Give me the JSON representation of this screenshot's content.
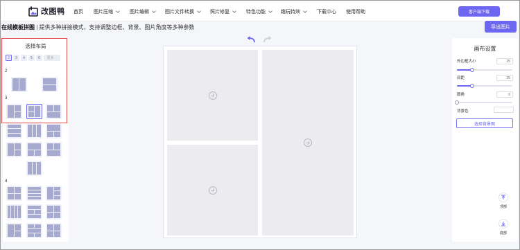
{
  "brand": {
    "name": "改图鸭"
  },
  "nav": {
    "items": [
      "首页",
      "图片压缩",
      "图片编辑",
      "图片文件转换",
      "照片修复",
      "特色功能",
      "趣玩特效",
      "下载中心",
      "使用帮助"
    ],
    "client_download": "客户端下载"
  },
  "subheader": {
    "title": "在线模板拼图",
    "separator": " | ",
    "description": "提供多种拼接模式，支持调整边框、背景、图片角度等多种参数",
    "export_button": "导出图片"
  },
  "layout_panel": {
    "title": "选择布局",
    "count_tabs": [
      "2",
      "3",
      "4",
      "5",
      "6",
      "更多 ··"
    ],
    "active_tab": "2",
    "sections": [
      "2",
      "3",
      "4"
    ]
  },
  "canvas_panel": {
    "title": "画布设置",
    "outer_border_label": "外边框大小",
    "outer_border_value": "25",
    "outer_border_fraction": 0.28,
    "spacing_label": "间距",
    "spacing_value": "25",
    "spacing_fraction": 0.28,
    "corner_label": "圆角",
    "corner_value": "0",
    "corner_fraction": 0,
    "bg_color_label": "背景色",
    "bg_image_button": "选择背景图"
  },
  "side_actions": {
    "top": "顶部",
    "bottom": "底部"
  },
  "colors": {
    "accent": "#6c66f0",
    "highlight": "#e34a4a",
    "placeholder": "#ececf0",
    "thumb": "#a6aace"
  }
}
